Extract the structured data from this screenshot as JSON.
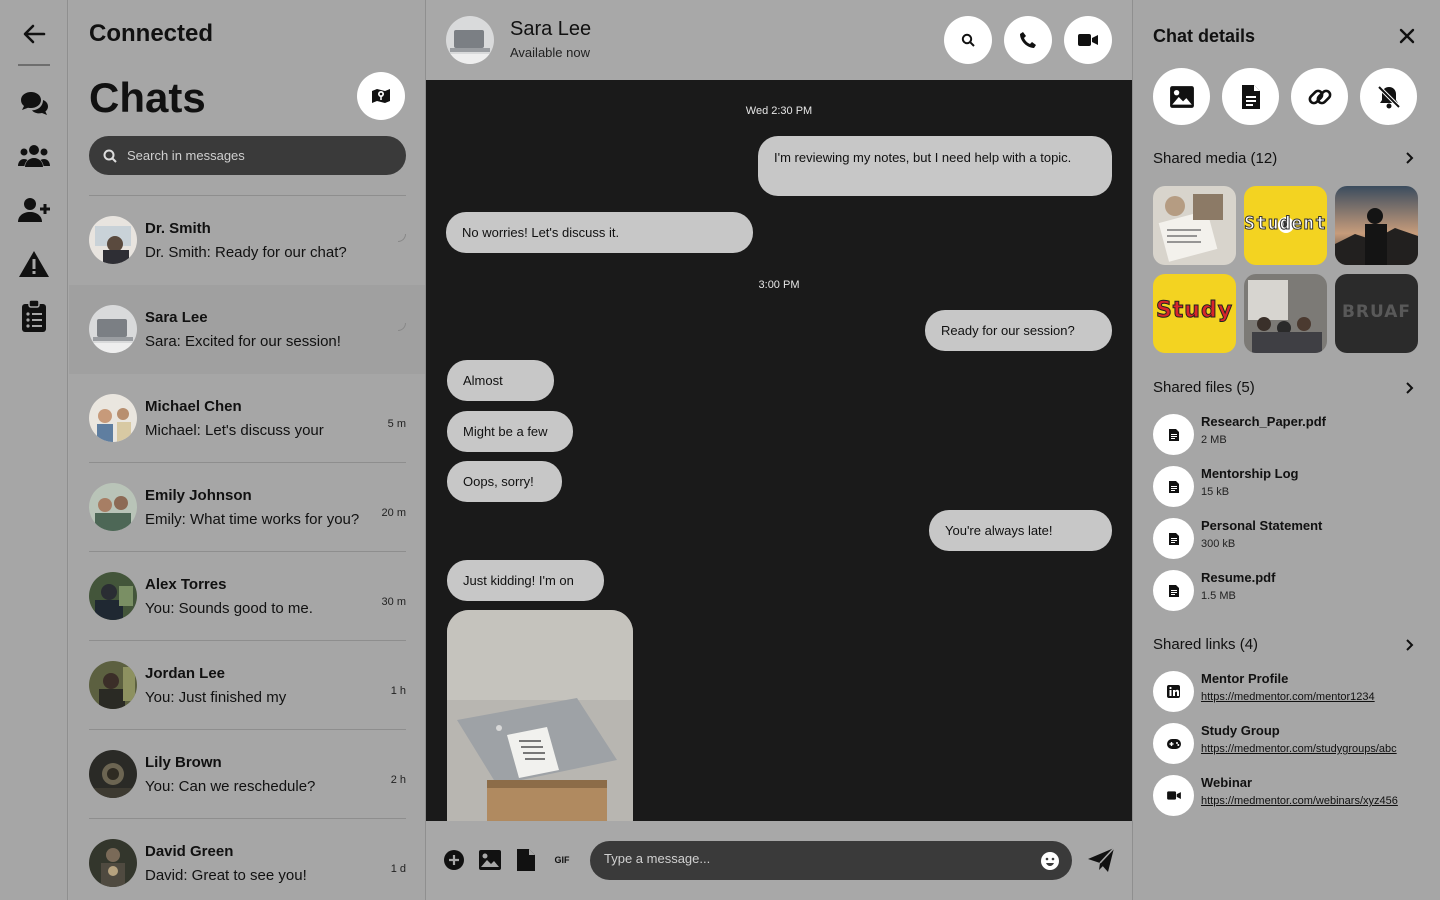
{
  "sidebar": {
    "app_title": "Connected",
    "heading": "Chats",
    "search_placeholder": "Search in messages",
    "conversations": [
      {
        "name": "Dr. Smith",
        "preview": "Dr. Smith: Ready for our chat?",
        "time": ""
      },
      {
        "name": "Sara Lee",
        "preview": "Sara: Excited for our session!",
        "time": ""
      },
      {
        "name": "Michael Chen",
        "preview": "Michael: Let's discuss your",
        "time": "5 m"
      },
      {
        "name": "Emily Johnson",
        "preview": "Emily: What time works for you?",
        "time": "20 m"
      },
      {
        "name": "Alex Torres",
        "preview": "You: Sounds good to me.",
        "time": "30 m"
      },
      {
        "name": "Jordan Lee",
        "preview": "You: Just finished my",
        "time": "1 h"
      },
      {
        "name": "Lily Brown",
        "preview": "You: Can we reschedule?",
        "time": "2 h"
      },
      {
        "name": "David Green",
        "preview": "David: Great to see you!",
        "time": "1 d"
      }
    ]
  },
  "chat": {
    "contact_name": "Sara Lee",
    "contact_status": "Available now",
    "timestamps": [
      "Wed 2:30 PM",
      "3:00 PM"
    ],
    "messages": [
      {
        "text": "I'm reviewing my notes, but I need help with a topic.",
        "from": "me"
      },
      {
        "text": "No worries! Let's discuss it.",
        "from": "them"
      },
      {
        "text": "Ready for our session?",
        "from": "me"
      },
      {
        "text": "Almost",
        "from": "them"
      },
      {
        "text": "Might be a few",
        "from": "them"
      },
      {
        "text": "Oops, sorry!",
        "from": "them"
      },
      {
        "text": "You're always late!",
        "from": "me"
      },
      {
        "text": "Just kidding! I'm on",
        "from": "them"
      }
    ],
    "composer_placeholder": "Type a message...",
    "gif_label": "GIF"
  },
  "details": {
    "title": "Chat details",
    "media_heading": "Shared media (12)",
    "media_thumbs": [
      "notes",
      "student",
      "silhouette",
      "study",
      "meeting",
      "dark-text"
    ],
    "files_heading": "Shared files (5)",
    "files": [
      {
        "name": "Research_Paper.pdf",
        "size": "2 MB"
      },
      {
        "name": "Mentorship Log",
        "size": "15 kB"
      },
      {
        "name": "Personal Statement",
        "size": "300 kB"
      },
      {
        "name": "Resume.pdf",
        "size": "1.5 MB"
      }
    ],
    "links_heading": "Shared links (4)",
    "links": [
      {
        "name": "Mentor Profile",
        "url": "https://medmentor.com/mentor1234",
        "icon": "linkedin-icon"
      },
      {
        "name": "Study Group",
        "url": "https://medmentor.com/studygroups/abc",
        "icon": "gamepad-icon"
      },
      {
        "name": "Webinar",
        "url": "https://medmentor.com/webinars/xyz456",
        "icon": "video-icon"
      }
    ],
    "thumb_words": {
      "student": "Student",
      "study": "Study",
      "dark": "BRUAF"
    }
  },
  "colors": {
    "panel": "#a6a6a6",
    "chat_bg": "#1a1a1a",
    "bubble": "#c7c7c7",
    "input_bg": "#3a3a3a",
    "button_bg": "#ffffff"
  }
}
